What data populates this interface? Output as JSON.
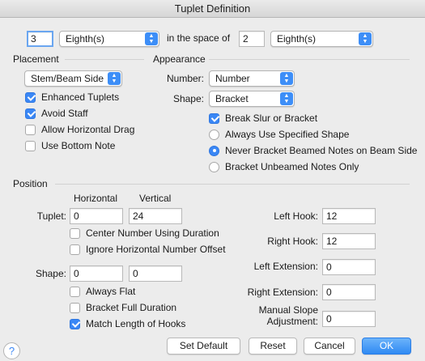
{
  "window": {
    "title": "Tuplet Definition"
  },
  "top": {
    "count": "3",
    "count_unit": "Eighth(s)",
    "in_space_label": "in the space of",
    "space": "2",
    "space_unit": "Eighth(s)"
  },
  "placement": {
    "title": "Placement",
    "mode": "Stem/Beam Side",
    "enhanced_tuplets": "Enhanced Tuplets",
    "avoid_staff": "Avoid Staff",
    "allow_horizontal_drag": "Allow Horizontal Drag",
    "use_bottom_note": "Use Bottom Note"
  },
  "appearance": {
    "title": "Appearance",
    "number_label": "Number:",
    "number_value": "Number",
    "shape_label": "Shape:",
    "shape_value": "Bracket",
    "break_slur": "Break Slur or Bracket",
    "always_use_shape": "Always Use Specified Shape",
    "never_bracket_beamed": "Never Bracket Beamed Notes on Beam Side",
    "bracket_unbeamed": "Bracket Unbeamed Notes Only"
  },
  "position": {
    "title": "Position",
    "horizontal_header": "Horizontal",
    "vertical_header": "Vertical",
    "tuplet_label": "Tuplet:",
    "tuplet_h": "0",
    "tuplet_v": "24",
    "center_number": "Center Number Using Duration",
    "ignore_offset": "Ignore Horizontal Number Offset",
    "shape_label": "Shape:",
    "shape_h": "0",
    "shape_v": "0",
    "always_flat": "Always Flat",
    "bracket_full_duration": "Bracket Full Duration",
    "match_hooks": "Match Length of Hooks",
    "left_hook_label": "Left Hook:",
    "left_hook": "12",
    "right_hook_label": "Right Hook:",
    "right_hook": "12",
    "left_ext_label": "Left Extension:",
    "left_ext": "0",
    "right_ext_label": "Right Extension:",
    "right_ext": "0",
    "manual_slope_label_1": "Manual Slope",
    "manual_slope_label_2": "Adjustment:",
    "manual_slope": "0"
  },
  "buttons": {
    "help": "?",
    "set_default": "Set Default",
    "reset": "Reset",
    "cancel": "Cancel",
    "ok": "OK"
  },
  "colors": {
    "accent": "#3a87f5",
    "background": "#ececec"
  }
}
